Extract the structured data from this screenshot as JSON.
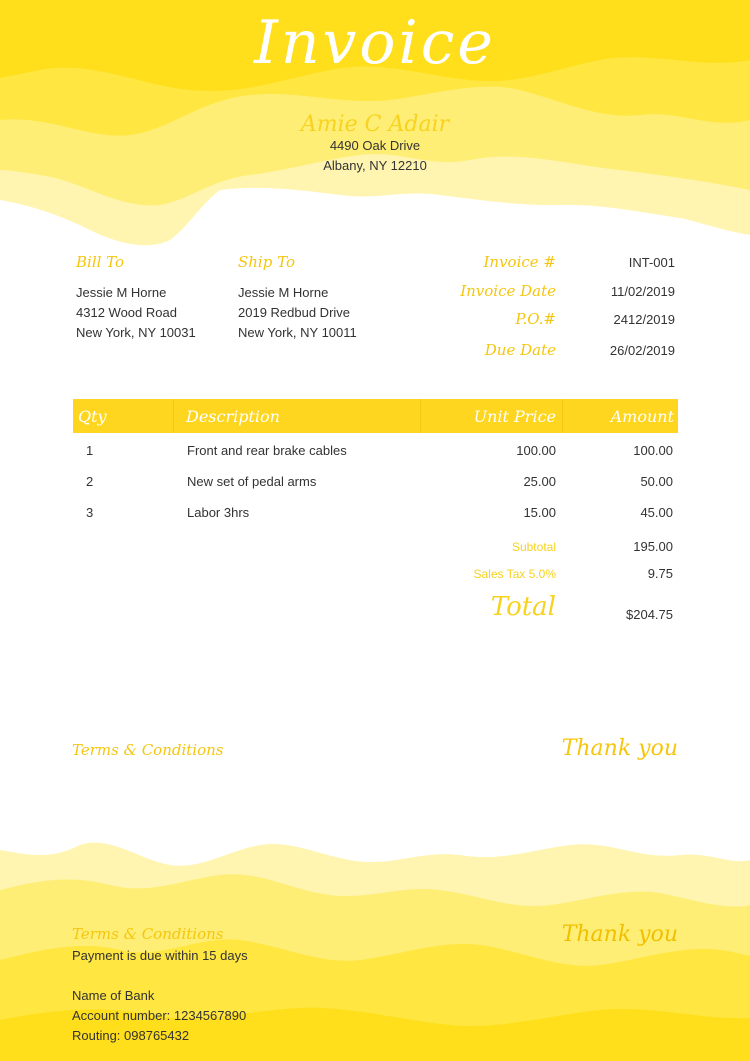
{
  "invoice_title": "Invoice",
  "company": {
    "name": "Amie C Adair",
    "address_line1": "4490 Oak Drive",
    "address_line2": "Albany, NY 12210"
  },
  "bill_to": {
    "label": "Bill To",
    "name": "Jessie M Horne",
    "street": "4312 Wood Road",
    "city": "New York, NY 10031"
  },
  "ship_to": {
    "label": "Ship To",
    "name": "Jessie M Horne",
    "street": "2019 Redbud Drive",
    "city": "New York, NY 10011"
  },
  "meta": [
    {
      "label": "Invoice #",
      "value": "INT-001"
    },
    {
      "label": "Invoice Date",
      "value": "11/02/2019"
    },
    {
      "label": "P.O.#",
      "value": "2412/2019"
    },
    {
      "label": "Due Date",
      "value": "26/02/2019"
    }
  ],
  "table": {
    "headers": {
      "qty": "Qty",
      "description": "Description",
      "unit_price": "Unit Price",
      "amount": "Amount"
    },
    "rows": [
      {
        "qty": "1",
        "description": "Front and rear brake cables",
        "unit_price": "100.00",
        "amount": "100.00"
      },
      {
        "qty": "2",
        "description": "New set of pedal arms",
        "unit_price": "25.00",
        "amount": "50.00"
      },
      {
        "qty": "3",
        "description": "Labor 3hrs",
        "unit_price": "15.00",
        "amount": "45.00"
      }
    ]
  },
  "summary": {
    "subtotal_label": "Subtotal",
    "subtotal_value": "195.00",
    "tax_label": "Sales Tax 5.0%",
    "tax_value": "9.75",
    "total_label": "Total",
    "total_value": "$204.75"
  },
  "terms_heading": "Terms & Conditions",
  "thank_you": "Thank you",
  "footer": {
    "terms_heading": "Terms & Conditions",
    "payment_terms": "Payment is due within 15 days",
    "bank_name": "Name of Bank",
    "account_number": "Account number: 1234567890",
    "routing": "Routing: 098765432",
    "thank_you": "Thank you"
  },
  "colors": {
    "accent": "#ffd61f",
    "accent_text": "#f5c60f",
    "body_text": "#333333"
  }
}
